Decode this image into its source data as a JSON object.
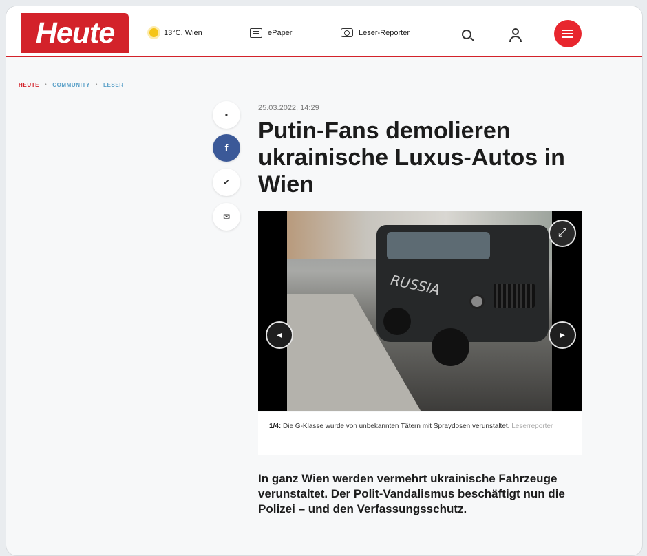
{
  "header": {
    "logo": "Heute",
    "weather": "13°C, Wien",
    "epaper": "ePaper",
    "reporter": "Leser-Reporter",
    "brand_color": "#d3222a"
  },
  "breadcrumb": {
    "items": [
      "HEUTE",
      "COMMUNITY",
      "LESER"
    ],
    "separator": "•"
  },
  "share": {
    "icons": [
      "comment-icon",
      "facebook-icon",
      "twitter-icon",
      "mail-icon"
    ]
  },
  "article": {
    "date": "25.03.2022, 14:29",
    "title": "Putin-Fans demolieren ukrainische Luxus-Autos in Wien",
    "gallery": {
      "counter": "1/4:",
      "caption": "Die G-Klasse wurde von unbekannten Tätern mit Spraydosen verunstaltet.",
      "credit": "Leserreporter",
      "spray_text": "RUSSIA"
    },
    "lead": "In ganz Wien werden vermehrt ukrainische Fahrzeuge verunstaltet. Der Polit-Vandalismus beschäftigt nun die Polizei – und den Verfassungsschutz."
  }
}
